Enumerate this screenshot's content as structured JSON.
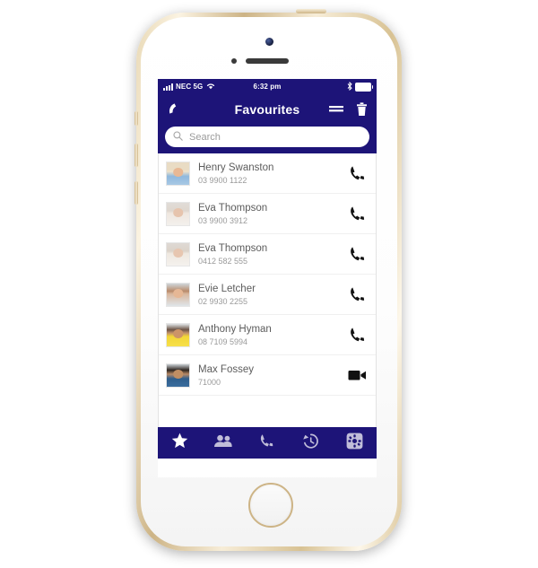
{
  "device": {
    "name": "iphone-5s-gold",
    "frame_color": "#cdb486",
    "face_color": "#ffffff"
  },
  "theme": {
    "navy": "#1d1478",
    "screen_bg": "#ffffff",
    "name_color": "#5c5c5c",
    "number_color": "#9a9a9a",
    "icon_color": "#000000"
  },
  "status_bar": {
    "carrier": "NEC 5G",
    "time": "6:32 pm",
    "signal_icon": "signal-bars-icon",
    "wifi_icon": "wifi-icon",
    "bluetooth_icon": "bluetooth-icon",
    "battery_icon": "battery-icon"
  },
  "nav_bar": {
    "back_icon": "phone-handset-back-icon",
    "title": "Favourites",
    "menu_icon": "hamburger-menu-icon",
    "delete_icon": "trash-icon"
  },
  "search": {
    "placeholder": "Search",
    "value": "",
    "icon": "search-icon"
  },
  "contacts": [
    {
      "name": "Henry Swanston",
      "number": "03 9900 1122",
      "action": "call-icon",
      "avatar": "avatar-henry"
    },
    {
      "name": "Eva Thompson",
      "number": "03 9900 3912",
      "action": "call-icon",
      "avatar": "avatar-eva-1"
    },
    {
      "name": "Eva Thompson",
      "number": "0412 582 555",
      "action": "call-icon",
      "avatar": "avatar-eva-2"
    },
    {
      "name": "Evie Letcher",
      "number": "02 9930 2255",
      "action": "call-icon",
      "avatar": "avatar-evie"
    },
    {
      "name": "Anthony Hyman",
      "number": "08 7109 5994",
      "action": "call-icon",
      "avatar": "avatar-anthony"
    },
    {
      "name": "Max Fossey",
      "number": "71000",
      "action": "video-icon",
      "avatar": "avatar-max"
    }
  ],
  "tab_bar": {
    "items": [
      {
        "name": "tab-favourites",
        "icon": "star-icon",
        "active": true
      },
      {
        "name": "tab-contacts",
        "icon": "people-icon",
        "active": false
      },
      {
        "name": "tab-keypad",
        "icon": "phone-icon",
        "active": false
      },
      {
        "name": "tab-history",
        "icon": "history-icon",
        "active": false
      },
      {
        "name": "tab-settings",
        "icon": "gear-icon",
        "active": false
      }
    ]
  }
}
